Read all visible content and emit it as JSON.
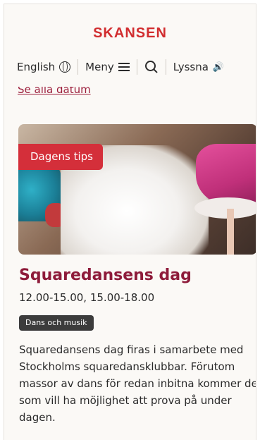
{
  "header": {
    "logo_text": "SKANSEN",
    "brand_color": "#d12d2f",
    "nav": {
      "language_label": "English",
      "language_icon": "globe-icon",
      "menu_label": "Meny",
      "menu_icon": "hamburger-icon",
      "search_icon": "search-icon",
      "listen_label": "Lyssna",
      "listen_icon": "speaker-icon"
    }
  },
  "all_dates_link": "Se alla datum",
  "card": {
    "badge": "Dagens tips",
    "badge_color": "#d42f3a",
    "title": "Squaredansens dag",
    "title_color": "#8e1b3a",
    "time": "12.00-15.00, 15.00-18.00",
    "tag": "Dans och musik",
    "description": "Squaredansens dag firas i samarbete med Stockholms squaredansklubbar. Förutom massor av dans för redan inbitna kommer de som vill ha möjlighet att prova på under dagen."
  }
}
